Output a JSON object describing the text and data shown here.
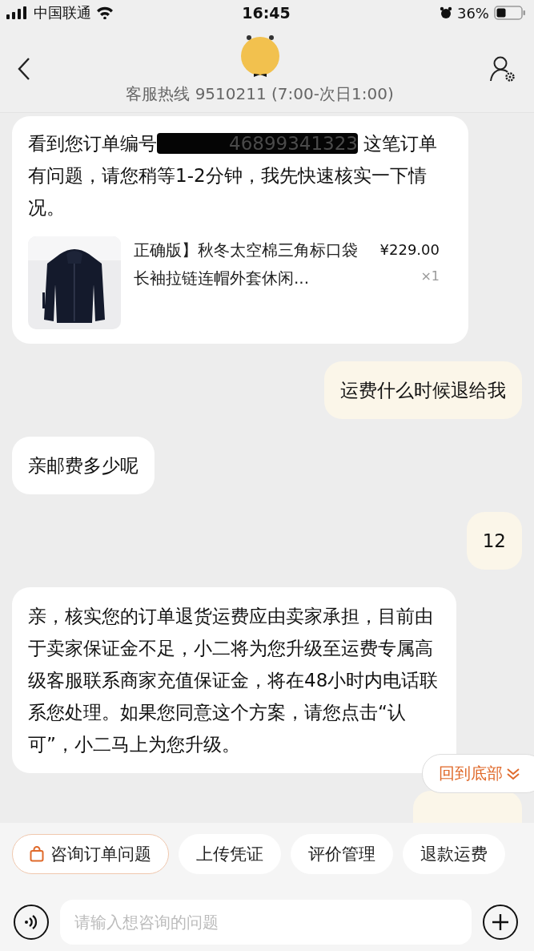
{
  "status_bar": {
    "carrier": "中国联通",
    "time": "16:45",
    "battery": "36%"
  },
  "header": {
    "hotline": "客服热线 9510211 (7:00-次日1:00)"
  },
  "messages": [
    {
      "from_user": false,
      "kind": "order",
      "text_before": "看到您订单编号",
      "order_number": "46899341323",
      "text_after": " 这笔订单有问题，请您稍等1-2分钟，我先快速核实一下情况。",
      "product": {
        "title": "正确版】秋冬太空棉三角标口袋长袖拉链连帽外套休闲...",
        "price": "¥229.00",
        "quantity": "×1"
      }
    },
    {
      "from_user": true,
      "kind": "text",
      "text": "运费什么时候退给我"
    },
    {
      "from_user": false,
      "kind": "text",
      "text": "亲邮费多少呢"
    },
    {
      "from_user": true,
      "kind": "text",
      "text": "12"
    },
    {
      "from_user": false,
      "kind": "text",
      "text": "亲，核实您的订单退货运费应由卖家承担，目前由于卖家保证金不足，小二将为您升级至运费专属高级客服联系商家充值保证金，将在48小时内电话联系您处理。如果您同意这个方案，请您点击“认可”，小二马上为您升级。"
    },
    {
      "from_user": true,
      "kind": "cut_off"
    }
  ],
  "scroll_button": {
    "label": "回到底部"
  },
  "quick_replies": [
    {
      "label": "咨询订单问题",
      "kind": "featured"
    },
    {
      "label": "上传凭证",
      "kind": "plain"
    },
    {
      "label": "评价管理",
      "kind": "plain"
    },
    {
      "label": "退款运费",
      "kind": "plain"
    }
  ],
  "input": {
    "placeholder": "请输入想咨询的问题"
  }
}
